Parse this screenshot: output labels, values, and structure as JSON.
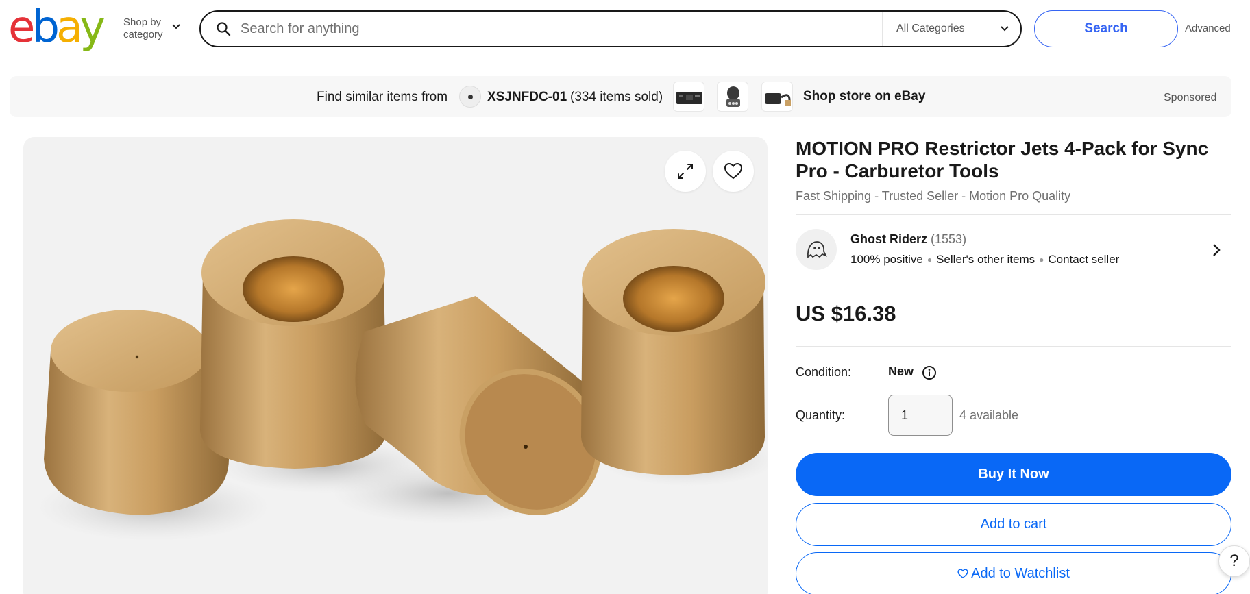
{
  "header": {
    "logo": {
      "letters": [
        "e",
        "b",
        "a",
        "y"
      ],
      "colors": [
        "#e53238",
        "#0064d2",
        "#f5af02",
        "#86b817"
      ]
    },
    "shop_by_category_line1": "Shop by",
    "shop_by_category_line2": "category",
    "search_placeholder": "Search for anything",
    "category_select": "All Categories",
    "search_button": "Search",
    "advanced_link": "Advanced"
  },
  "banner": {
    "find_similar": "Find similar items from",
    "store_name": "XSJNFDC-01",
    "items_sold": "(334 items sold)",
    "shop_store_link": "Shop store on eBay",
    "sponsored": "Sponsored"
  },
  "product": {
    "title": "MOTION PRO Restrictor Jets 4-Pack for Sync Pro - Carburetor Tools",
    "subtitle": "Fast Shipping - Trusted Seller - Motion Pro Quality",
    "price": "US $16.38",
    "condition_label": "Condition:",
    "condition_value": "New",
    "quantity_label": "Quantity:",
    "quantity_value": "1",
    "available": "4 available"
  },
  "seller": {
    "name": "Ghost Riderz",
    "feedback_count": "(1553)",
    "positive": "100% positive",
    "other_items": "Seller's other items",
    "contact": "Contact seller"
  },
  "actions": {
    "buy_now": "Buy It Now",
    "add_to_cart": "Add to cart",
    "add_to_watchlist": "Add to Watchlist",
    "help": "?"
  },
  "colors": {
    "accent_blue": "#0968f6",
    "search_blue": "#3665f3",
    "brass": "#c9a064"
  },
  "icons": [
    "search-icon",
    "chevron-down-icon",
    "expand-icon",
    "heart-icon",
    "ghost-icon",
    "chevron-right-icon",
    "info-icon"
  ]
}
